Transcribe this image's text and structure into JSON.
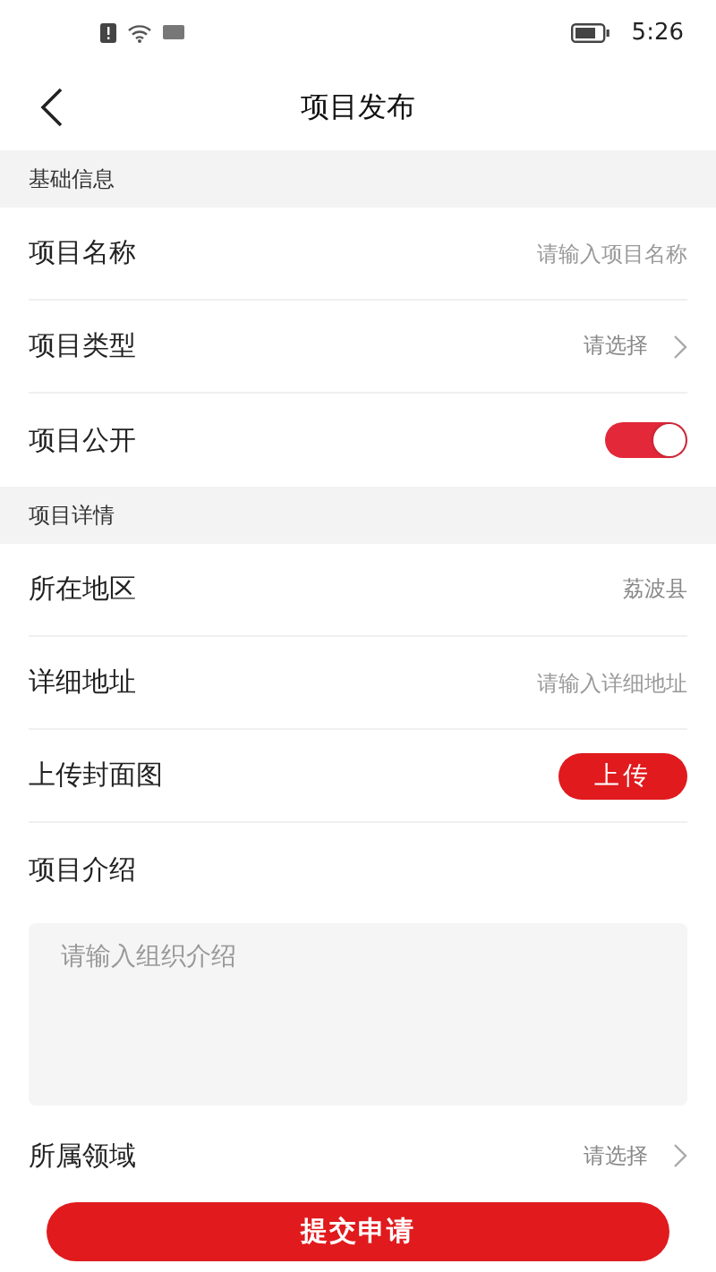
{
  "status_bar": {
    "time": "5:26"
  },
  "header": {
    "title": "项目发布"
  },
  "sections": [
    {
      "title": "基础信息",
      "rows": [
        {
          "kind": "input",
          "label": "项目名称",
          "placeholder": "请输入项目名称"
        },
        {
          "kind": "select",
          "label": "项目类型",
          "value": "请选择"
        },
        {
          "kind": "toggle",
          "label": "项目公开",
          "on": true
        }
      ]
    },
    {
      "title": "项目详情",
      "rows": [
        {
          "kind": "value",
          "label": "所在地区",
          "value": "荔波县"
        },
        {
          "kind": "input",
          "label": "详细地址",
          "placeholder": "请输入详细地址"
        },
        {
          "kind": "upload",
          "label": "上传封面图",
          "button": "上传"
        },
        {
          "kind": "textarea",
          "label": "项目介绍",
          "placeholder": "请输入组织介绍"
        },
        {
          "kind": "select",
          "label": "所属领域",
          "value": "请选择"
        }
      ]
    }
  ],
  "submit": "提交申请"
}
